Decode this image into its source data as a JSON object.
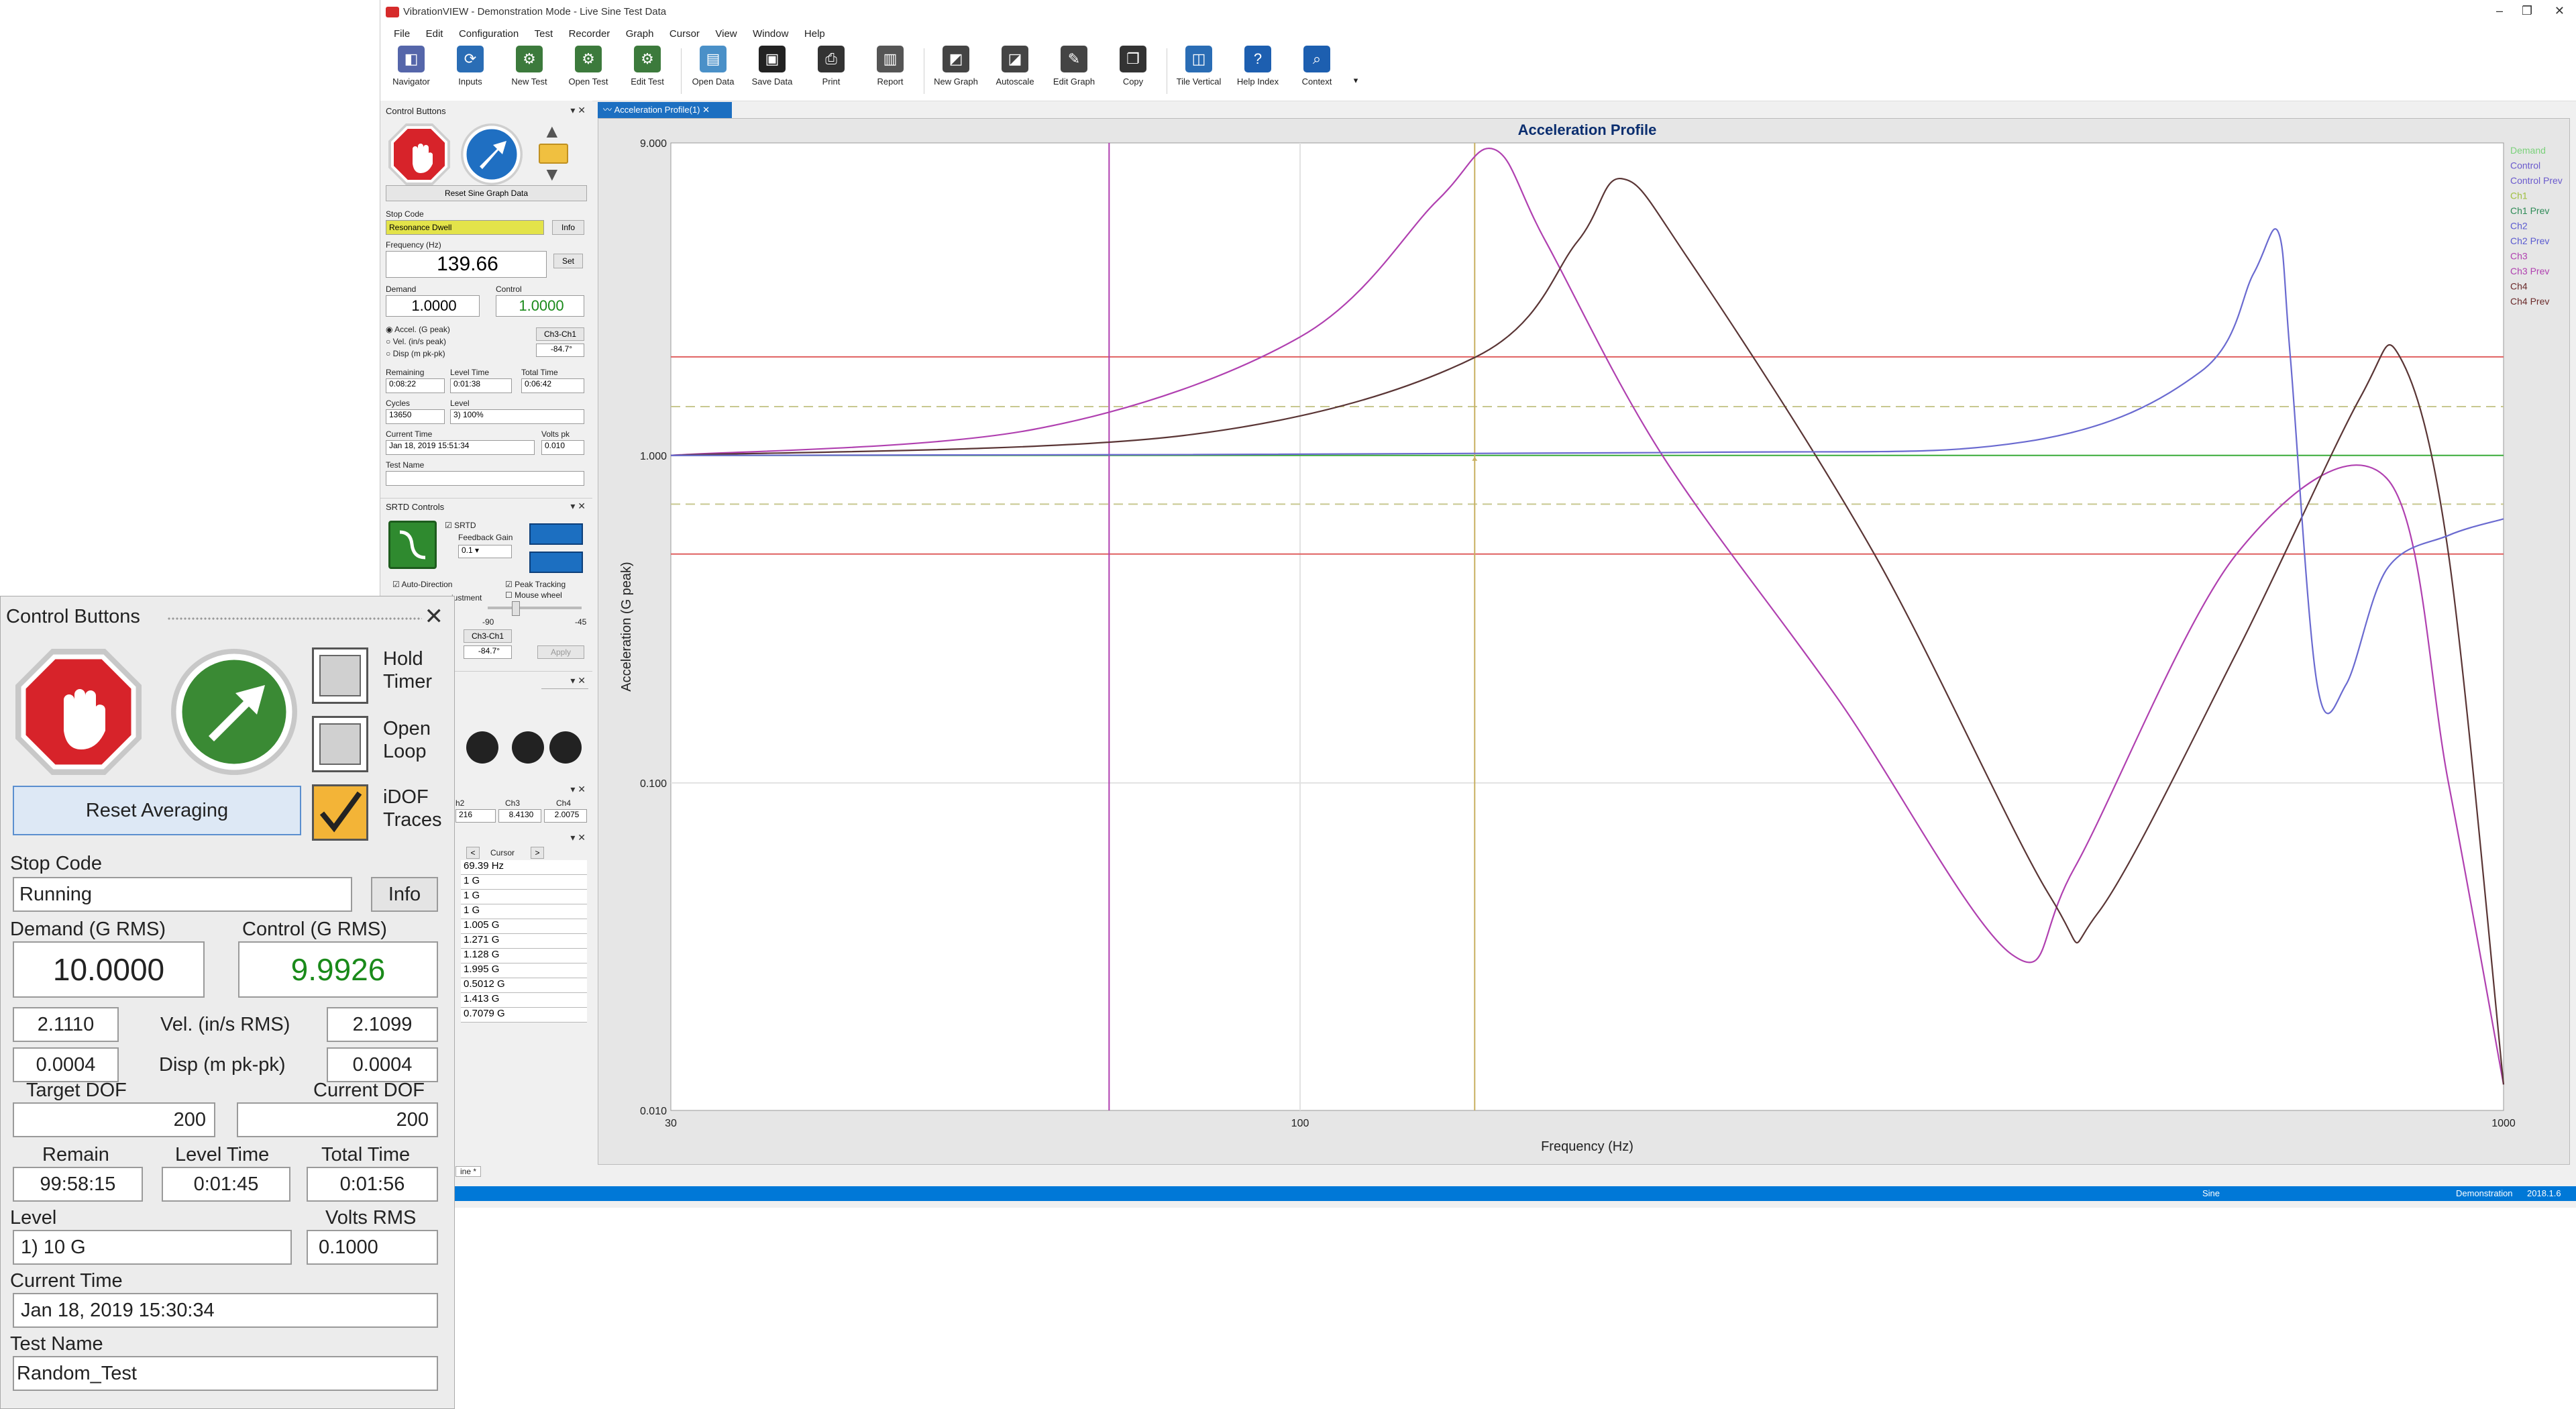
{
  "window": {
    "title": "VibrationVIEW - Demonstration Mode - Live Sine Test Data",
    "controls": [
      "–",
      "❐",
      "✕"
    ]
  },
  "menu": [
    "File",
    "Edit",
    "Configuration",
    "Test",
    "Recorder",
    "Graph",
    "Cursor",
    "View",
    "Window",
    "Help"
  ],
  "toolbar": [
    {
      "label": "Navigator",
      "icon": "navigator-icon",
      "color": "#5566aa"
    },
    {
      "label": "Inputs",
      "icon": "inputs-icon",
      "color": "#2a6db5"
    },
    {
      "label": "New Test",
      "icon": "new-test-icon",
      "color": "#3c7a3c"
    },
    {
      "label": "Open Test",
      "icon": "open-test-icon",
      "color": "#3c7a3c"
    },
    {
      "label": "Edit Test",
      "icon": "edit-test-icon",
      "color": "#3c7a3c"
    },
    {
      "label": "Open Data",
      "icon": "open-data-icon",
      "color": "#4a90c8"
    },
    {
      "label": "Save Data",
      "icon": "save-data-icon",
      "color": "#222222"
    },
    {
      "label": "Print",
      "icon": "print-icon",
      "color": "#333333"
    },
    {
      "label": "Report",
      "icon": "report-icon",
      "color": "#555555"
    },
    {
      "label": "New Graph",
      "icon": "new-graph-icon",
      "color": "#444444"
    },
    {
      "label": "Autoscale",
      "icon": "autoscale-icon",
      "color": "#444444"
    },
    {
      "label": "Edit Graph",
      "icon": "edit-graph-icon",
      "color": "#444444"
    },
    {
      "label": "Copy",
      "icon": "copy-icon",
      "color": "#333333"
    },
    {
      "label": "Tile Vertical",
      "icon": "tile-vertical-icon",
      "color": "#2a6db5"
    },
    {
      "label": "Help Index",
      "icon": "help-index-icon",
      "color": "#1d5fb0"
    },
    {
      "label": "Context",
      "icon": "context-icon",
      "color": "#1d5fb0"
    }
  ],
  "dock": {
    "control_buttons_title": "Control Buttons",
    "reset_sine": "Reset Sine Graph Data",
    "stop_code_label": "Stop Code",
    "stop_code_value": "Resonance Dwell",
    "info": "Info",
    "frequency_label": "Frequency (Hz)",
    "frequency_value": "139.66",
    "set": "Set",
    "demand_label": "Demand",
    "demand_value": "1.0000",
    "control_label": "Control",
    "control_value": "1.0000",
    "radio_accel": "Accel. (G peak)",
    "radio_vel": "Vel. (in/s peak)",
    "radio_disp": "Disp (m pk-pk)",
    "ch_ratio": "Ch3-Ch1",
    "phase": "-84.7°",
    "remaining_label": "Remaining",
    "remaining_value": "0:08:22",
    "level_time_label": "Level Time",
    "level_time_value": "0:01:38",
    "total_time_label": "Total Time",
    "total_time_value": "0:06:42",
    "cycles_label": "Cycles",
    "cycles_value": "13650",
    "level_label": "Level",
    "level_value": "3) 100%",
    "current_time_label": "Current Time",
    "current_time_value": "Jan 18, 2019 15:51:34",
    "volts_label": "Volts pk",
    "volts_value": "0.010",
    "test_name_label": "Test Name",
    "srtd_title": "SRTD Controls",
    "srtd_check": "SRTD",
    "feedback_gain": "Feedback Gain",
    "gain_value": "0.1",
    "auto_direction": "Auto-Direction",
    "peak_tracking": "Peak Tracking",
    "mouse_wheel": "Mouse wheel",
    "adjustment": "justment",
    "scale_a": "-90",
    "scale_b": "-45",
    "ch_ratio2": "Ch3-Ch1",
    "phase2": "-84.7°",
    "apply": "Apply",
    "ch_headers": [
      "h2",
      "Ch3",
      "Ch4"
    ],
    "ch_values": [
      "216",
      "8.4130",
      "2.0075"
    ],
    "cursor_label": "Cursor",
    "cursor_rows": [
      "69.39  Hz",
      "1  G",
      "1  G",
      "1  G",
      "1.005  G",
      "1.271  G",
      "1.128  G",
      "1.995  G",
      "0.5012  G",
      "1.413  G",
      "0.7079  G"
    ],
    "tab_label": "ine *"
  },
  "graph": {
    "tab": "Acceleration Profile(1)"
  },
  "chart_data": {
    "type": "line",
    "title": "Acceleration Profile",
    "xlabel": "Frequency (Hz)",
    "ylabel": "Acceleration (G peak)",
    "xscale": "log",
    "yscale": "log",
    "xlim": [
      30,
      1000
    ],
    "ylim": [
      0.01,
      9.0
    ],
    "xticks": [
      "30",
      "100",
      "1000"
    ],
    "yticks": [
      "9.000",
      "1.000",
      "0.100",
      "0.010"
    ],
    "legend_placement": "right",
    "legend": [
      {
        "name": "Demand",
        "color": "#7bd17b"
      },
      {
        "name": "Control",
        "color": "#6a5acd"
      },
      {
        "name": "Control Prev",
        "color": "#6a5acd"
      },
      {
        "name": "Ch1",
        "color": "#a0c040"
      },
      {
        "name": "Ch1 Prev",
        "color": "#2e8b57"
      },
      {
        "name": "Ch2",
        "color": "#5a5ad0"
      },
      {
        "name": "Ch2 Prev",
        "color": "#5a5ad0"
      },
      {
        "name": "Ch3",
        "color": "#b040b0"
      },
      {
        "name": "Ch3 Prev",
        "color": "#b040b0"
      },
      {
        "name": "Ch4",
        "color": "#6a2a2a"
      },
      {
        "name": "Ch4 Prev",
        "color": "#6a2a2a"
      }
    ],
    "reference_lines": [
      {
        "name": "upper abort",
        "y": 2.0,
        "color": "#e06060",
        "dash": false
      },
      {
        "name": "upper alarm",
        "y": 1.41,
        "color": "#c8c890",
        "dash": true
      },
      {
        "name": "demand",
        "y": 1.0,
        "color": "#3cae3c",
        "dash": false
      },
      {
        "name": "lower alarm",
        "y": 0.71,
        "color": "#c8c890",
        "dash": true
      },
      {
        "name": "lower abort",
        "y": 0.5,
        "color": "#e06060",
        "dash": false
      }
    ],
    "cursor_lines": [
      {
        "x": 69.39,
        "color": "#b040b0"
      },
      {
        "x": 139.66,
        "color": "#c8b060"
      }
    ],
    "series": [
      {
        "name": "Ch3",
        "color": "#b040b0",
        "x": [
          30,
          60,
          100,
          130,
          145,
          160,
          200,
          280,
          390,
          440,
          600,
          800,
          900,
          1000
        ],
        "y": [
          1.0,
          1.2,
          2.3,
          6.0,
          8.6,
          4.5,
          1.0,
          0.18,
          0.03,
          0.055,
          0.5,
          0.85,
          0.1,
          0.012
        ]
      },
      {
        "name": "Ch4",
        "color": "#5a3535",
        "x": [
          30,
          80,
          140,
          170,
          185,
          210,
          300,
          420,
          460,
          600,
          760,
          820,
          900,
          1000
        ],
        "y": [
          1.0,
          1.15,
          2.0,
          4.5,
          7.0,
          4.0,
          0.5,
          0.045,
          0.04,
          0.25,
          1.5,
          2.0,
          0.5,
          0.012
        ]
      },
      {
        "name": "Control",
        "color": "#6a6ad0",
        "x": [
          30,
          200,
          400,
          560,
          620,
          650,
          665,
          700,
          740,
          800,
          900,
          1000
        ],
        "y": [
          1.0,
          1.02,
          1.1,
          1.8,
          3.6,
          4.8,
          2.0,
          0.2,
          0.2,
          0.45,
          0.57,
          0.64
        ]
      }
    ]
  },
  "statusbar": {
    "mode": "Sine",
    "right": "Demonstration",
    "version": "2018.1.6"
  },
  "float_panel": {
    "title": "Control Buttons",
    "hold_timer": "Hold\nTimer",
    "open_loop": "Open\nLoop",
    "idof": "iDOF\nTraces",
    "reset_averaging": "Reset Averaging",
    "stop_code_label": "Stop Code",
    "stop_code_value": "Running",
    "info": "Info",
    "demand_label": "Demand (G RMS)",
    "demand_value": "10.0000",
    "control_label": "Control (G RMS)",
    "control_value": "9.9926",
    "vel_left": "2.1110",
    "vel_label": "Vel. (in/s RMS)",
    "vel_right": "2.1099",
    "disp_left": "0.0004",
    "disp_label": "Disp (m pk-pk)",
    "disp_right": "0.0004",
    "target_dof_label": "Target DOF",
    "target_dof_value": "200",
    "current_dof_label": "Current DOF",
    "current_dof_value": "200",
    "remain_label": "Remain",
    "remain_value": "99:58:15",
    "level_time_label": "Level Time",
    "level_time_value": "0:01:45",
    "total_time_label": "Total Time",
    "total_time_value": "0:01:56",
    "level_label": "Level",
    "level_value": "1) 10 G",
    "volts_label": "Volts RMS",
    "volts_value": "0.1000",
    "current_time_label": "Current Time",
    "current_time_value": "Jan 18, 2019 15:30:34",
    "test_name_label": "Test Name",
    "test_name_value": "Random_Test"
  }
}
